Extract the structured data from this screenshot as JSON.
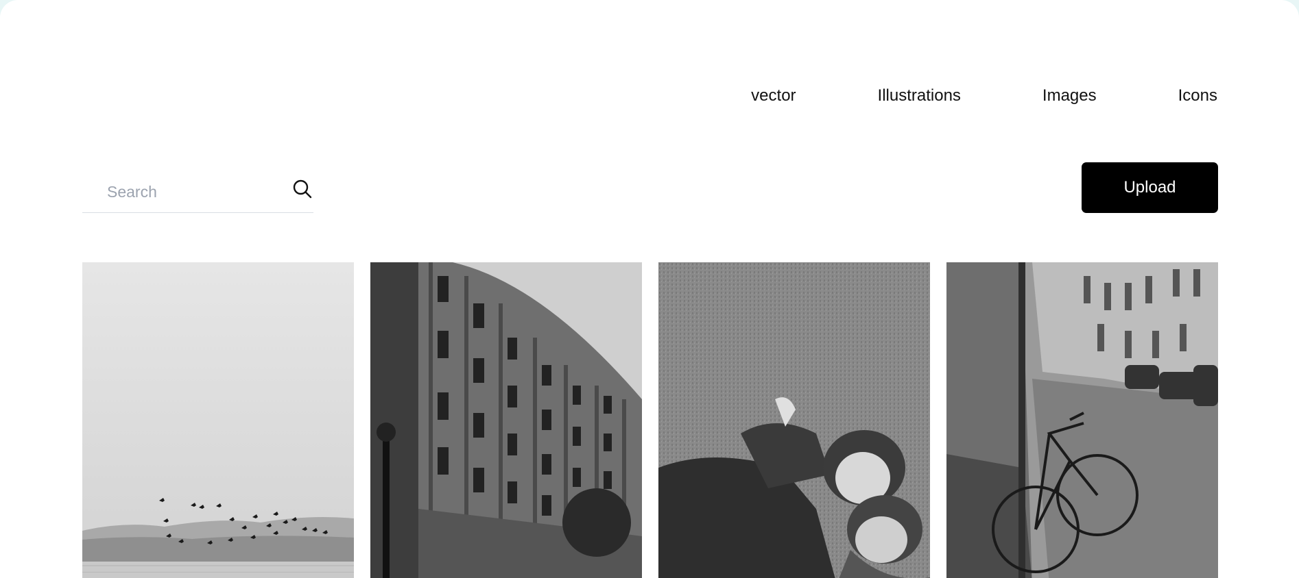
{
  "nav": {
    "items": [
      {
        "label": "vector"
      },
      {
        "label": "Illustrations"
      },
      {
        "label": "Images"
      },
      {
        "label": "Icons"
      }
    ]
  },
  "search": {
    "placeholder": "Search",
    "icon": "search-icon"
  },
  "upload": {
    "label": "Upload"
  },
  "gallery": {
    "photos": [
      {
        "subject": "birds-over-lake"
      },
      {
        "subject": "curved-building"
      },
      {
        "subject": "couple-on-grass"
      },
      {
        "subject": "bicycle-in-alley"
      }
    ]
  },
  "colors": {
    "accent": "#000000",
    "background": "#ffffff",
    "frame": "#e8f6f6"
  }
}
